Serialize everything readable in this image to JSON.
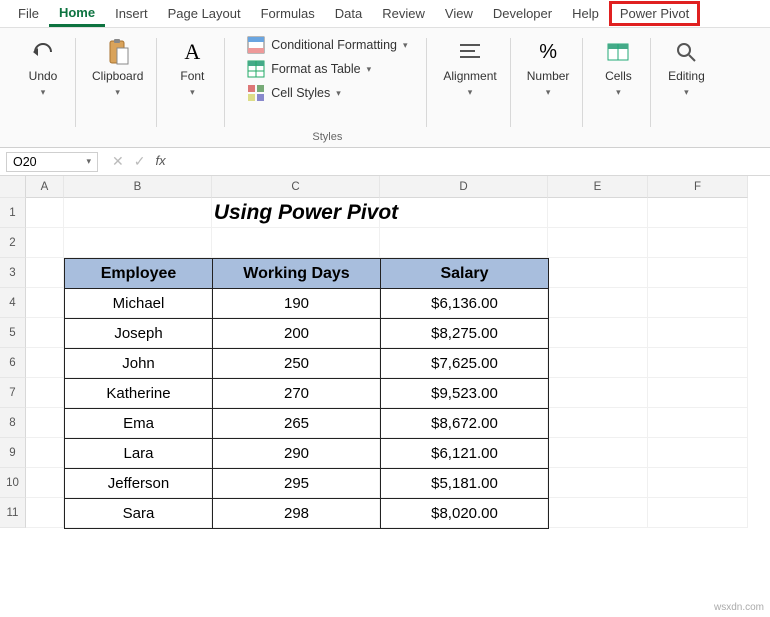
{
  "tabs": {
    "file": "File",
    "home": "Home",
    "insert": "Insert",
    "page_layout": "Page Layout",
    "formulas": "Formulas",
    "data": "Data",
    "review": "Review",
    "view": "View",
    "developer": "Developer",
    "help": "Help",
    "power_pivot": "Power Pivot"
  },
  "ribbon": {
    "undo": "Undo",
    "clipboard": "Clipboard",
    "font": "Font",
    "styles_label": "Styles",
    "cond_format": "Conditional Formatting",
    "format_table": "Format as Table",
    "cell_styles": "Cell Styles",
    "alignment": "Alignment",
    "number": "Number",
    "cells": "Cells",
    "editing": "Editing"
  },
  "namebox": "O20",
  "formula": "",
  "columns": {
    "A": "A",
    "B": "B",
    "C": "C",
    "D": "D",
    "E": "E",
    "F": "F"
  },
  "rows": [
    "1",
    "2",
    "3",
    "4",
    "5",
    "6",
    "7",
    "8",
    "9",
    "10",
    "11"
  ],
  "title": "Using Power Pivot",
  "table": {
    "headers": {
      "employee": "Employee",
      "days": "Working Days",
      "salary": "Salary"
    },
    "rows": [
      {
        "employee": "Michael",
        "days": "190",
        "salary": "$6,136.00"
      },
      {
        "employee": "Joseph",
        "days": "200",
        "salary": "$8,275.00"
      },
      {
        "employee": "John",
        "days": "250",
        "salary": "$7,625.00"
      },
      {
        "employee": "Katherine",
        "days": "270",
        "salary": "$9,523.00"
      },
      {
        "employee": "Ema",
        "days": "265",
        "salary": "$8,672.00"
      },
      {
        "employee": "Lara",
        "days": "290",
        "salary": "$6,121.00"
      },
      {
        "employee": "Jefferson",
        "days": "295",
        "salary": "$5,181.00"
      },
      {
        "employee": "Sara",
        "days": "298",
        "salary": "$8,020.00"
      }
    ]
  },
  "watermark": "wsxdn.com"
}
